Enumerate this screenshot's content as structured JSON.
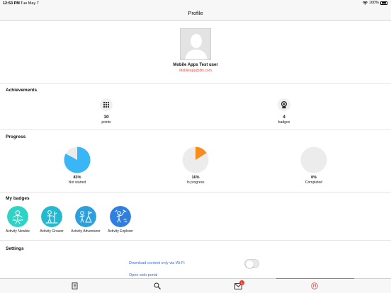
{
  "status_bar": {
    "time": "12:53 PM",
    "date": "Tue May 7",
    "battery": "100%",
    "battery_level": 1.0
  },
  "header": {
    "title": "Profile"
  },
  "user": {
    "name": "Mobile Apps Test user",
    "email": "Mobileapp@dfs.com"
  },
  "achievements": {
    "title": "Achievements",
    "points": {
      "value": "10",
      "label": "points",
      "icon": "grid-icon"
    },
    "badges": {
      "value": "4",
      "label": "badges",
      "icon": "award-icon"
    }
  },
  "progress": {
    "title": "Progress",
    "items": [
      {
        "value": "83%",
        "label": "Not started",
        "fraction": 0.83,
        "color": "#39b6f5"
      },
      {
        "value": "16%",
        "label": "In progress",
        "fraction": 0.16,
        "color": "#f78c1f"
      },
      {
        "value": "0%",
        "label": "Completed",
        "fraction": 0.0,
        "color": "#9ad14b"
      }
    ]
  },
  "my_badges": {
    "title": "My badges",
    "items": [
      {
        "label": "Activity Newbie",
        "color": "#2ed3c5"
      },
      {
        "label": "Activity Grower",
        "color": "#26b8cf"
      },
      {
        "label": "Activity Adventurer",
        "color": "#2c9fdc"
      },
      {
        "label": "Activity Explorer",
        "color": "#2f7fe0"
      }
    ]
  },
  "settings": {
    "title": "Settings",
    "wifi_label": "Download content only via Wi-Fi",
    "wifi_on": false,
    "portal_label": "Open web portal"
  },
  "tab_bar": {
    "notification_count": "1",
    "accent": "#e0684a",
    "tabs": [
      "book-icon",
      "search-icon",
      "mail-icon",
      "profile-icon"
    ]
  }
}
